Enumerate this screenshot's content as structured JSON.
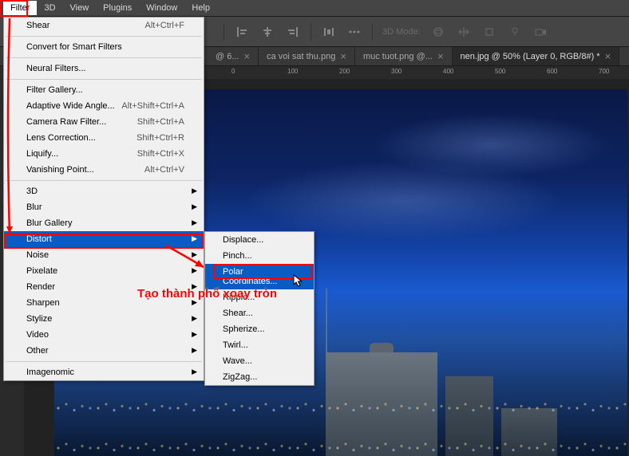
{
  "menubar": [
    "Filter",
    "3D",
    "View",
    "Plugins",
    "Window",
    "Help"
  ],
  "toolbar": {
    "mode_label": "3D Mode:"
  },
  "tabs": [
    {
      "label": "@ 6...",
      "active": false
    },
    {
      "label": "ca voi sat thu.png",
      "active": false
    },
    {
      "label": "muc tuot.png @...",
      "active": false
    },
    {
      "label": "nen.jpg @ 50% (Layer 0, RGB/8#) *",
      "active": true
    }
  ],
  "ruler_ticks": [
    "0",
    "100",
    "200",
    "300",
    "400",
    "500",
    "600",
    "700"
  ],
  "filter_menu": {
    "top": {
      "label": "Shear",
      "shortcut": "Alt+Ctrl+F"
    },
    "smart": "Convert for Smart Filters",
    "neural": "Neural Filters...",
    "gallery": [
      {
        "label": "Filter Gallery...",
        "shortcut": ""
      },
      {
        "label": "Adaptive Wide Angle...",
        "shortcut": "Alt+Shift+Ctrl+A"
      },
      {
        "label": "Camera Raw Filter...",
        "shortcut": "Shift+Ctrl+A"
      },
      {
        "label": "Lens Correction...",
        "shortcut": "Shift+Ctrl+R"
      },
      {
        "label": "Liquify...",
        "shortcut": "Shift+Ctrl+X"
      },
      {
        "label": "Vanishing Point...",
        "shortcut": "Alt+Ctrl+V"
      }
    ],
    "categories": [
      "3D",
      "Blur",
      "Blur Gallery",
      "Distort",
      "Noise",
      "Pixelate",
      "Render",
      "Sharpen",
      "Stylize",
      "Video",
      "Other"
    ],
    "bottom": "Imagenomic"
  },
  "distort_submenu": [
    "Displace...",
    "Pinch...",
    "Polar Coordinates...",
    "Ripple...",
    "Shear...",
    "Spherize...",
    "Twirl...",
    "Wave...",
    "ZigZag..."
  ],
  "annotation_text": "Tạo thành phố xoay tròn"
}
